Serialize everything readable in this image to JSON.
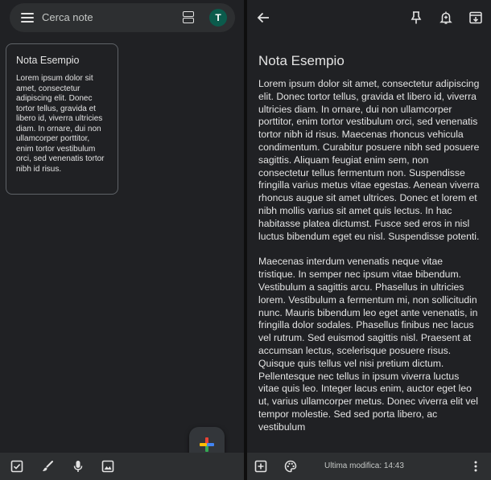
{
  "list": {
    "search_placeholder": "Cerca note",
    "avatar_letter": "T",
    "note": {
      "title": "Nota Esempio",
      "preview": "Lorem ipsum dolor sit amet, consectetur adipiscing elit. Donec tortor tellus, gravida et libero id, viverra ultricies diam. In ornare, dui non ullamcorper porttitor, enim tortor vestibulum orci, sed venenatis tortor nibh id risus."
    }
  },
  "editor": {
    "title": "Nota Esempio",
    "paragraph1": "Lorem ipsum dolor sit amet, consectetur adipiscing elit. Donec tortor tellus, gravida et libero id, viverra ultricies diam. In ornare, dui non ullamcorper porttitor, enim tortor vestibulum orci, sed venenatis tortor nibh id risus. Maecenas rhoncus vehicula condimentum. Curabitur posuere nibh sed posuere sagittis. Aliquam feugiat enim sem, non consectetur tellus fermentum non. Suspendisse fringilla varius metus vitae egestas. Aenean viverra rhoncus augue sit amet ultrices. Donec et lorem et nibh mollis varius sit amet quis lectus. In hac habitasse platea dictumst. Fusce sed eros in nisl luctus bibendum eget eu nisl. Suspendisse potenti.",
    "paragraph2": "Maecenas interdum venenatis neque vitae tristique. In semper nec ipsum vitae bibendum. Vestibulum a sagittis arcu. Phasellus in ultricies lorem. Vestibulum a fermentum mi, non sollicitudin nunc. Mauris bibendum leo eget ante venenatis, in fringilla dolor sodales. Phasellus finibus nec lacus vel rutrum. Sed euismod sagittis nisl. Praesent at accumsan lectus, scelerisque posuere risus. Quisque quis tellus vel nisi pretium dictum. Pellentesque nec tellus in ipsum viverra luctus vitae quis leo. Integer lacus enim, auctor eget leo ut, varius ullamcorper metus. Donec viverra elit vel tempor molestie. Sed sed porta libero, ac vestibulum",
    "last_modified": "Ultima modifica: 14:43"
  },
  "colors": {
    "background": "#202124",
    "surface": "#2d2f31",
    "avatar": "#0b5b4c",
    "card_border": "#5f6368",
    "fab_blue": "#4285f4",
    "fab_red": "#ea4335",
    "fab_yellow": "#fbbc04",
    "fab_green": "#34a853"
  },
  "icons": {
    "menu": "menu-icon",
    "layout": "grid-view-icon",
    "back": "arrow-back-icon",
    "pin": "pin-icon",
    "reminder": "bell-plus-icon",
    "archive": "archive-icon",
    "checkbox": "checkbox-icon",
    "draw": "brush-icon",
    "mic": "mic-icon",
    "image": "image-icon",
    "add_box": "add-box-icon",
    "palette": "palette-icon",
    "more": "more-vert-icon"
  }
}
